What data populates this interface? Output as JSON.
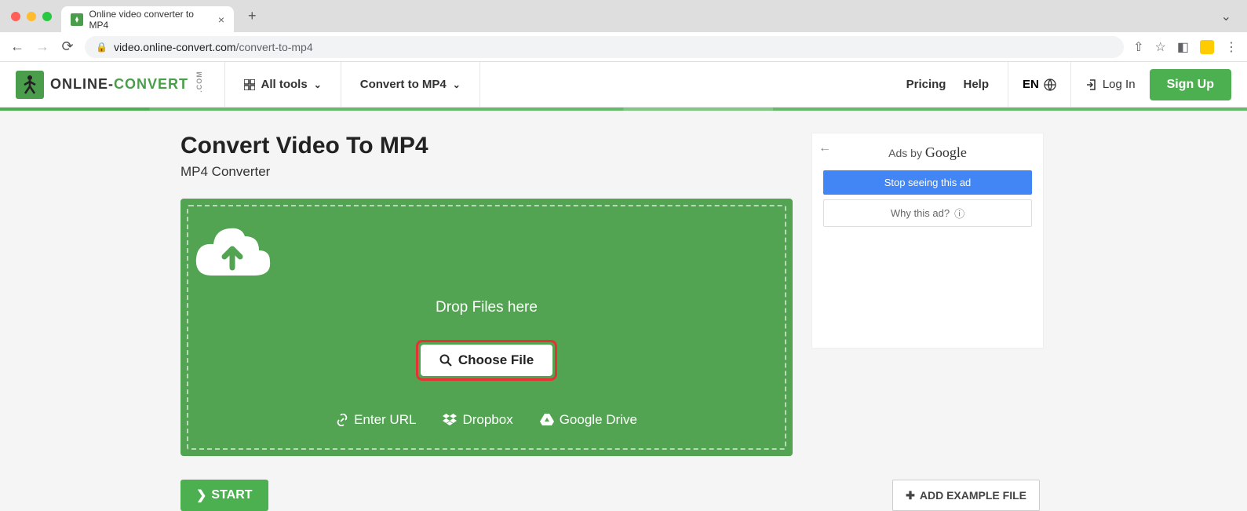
{
  "browser": {
    "tab_title": "Online video converter to MP4",
    "url_domain": "video.online-convert.com",
    "url_path": "/convert-to-mp4"
  },
  "header": {
    "logo_text_1": "ONLINE-",
    "logo_text_2": "CONVERT",
    "logo_com": ".COM",
    "all_tools": "All tools",
    "convert_to": "Convert to MP4",
    "pricing": "Pricing",
    "help": "Help",
    "lang": "EN",
    "login": "Log In",
    "signup": "Sign Up"
  },
  "page": {
    "title": "Convert Video To MP4",
    "subtitle": "MP4 Converter"
  },
  "dropzone": {
    "drop_text": "Drop Files here",
    "choose_file": "Choose File",
    "enter_url": "Enter URL",
    "dropbox": "Dropbox",
    "gdrive": "Google Drive"
  },
  "actions": {
    "start": "START",
    "add_example": "ADD EXAMPLE FILE"
  },
  "ad": {
    "header_prefix": "Ads by ",
    "google": "Google",
    "stop": "Stop seeing this ad",
    "why": "Why this ad?"
  }
}
